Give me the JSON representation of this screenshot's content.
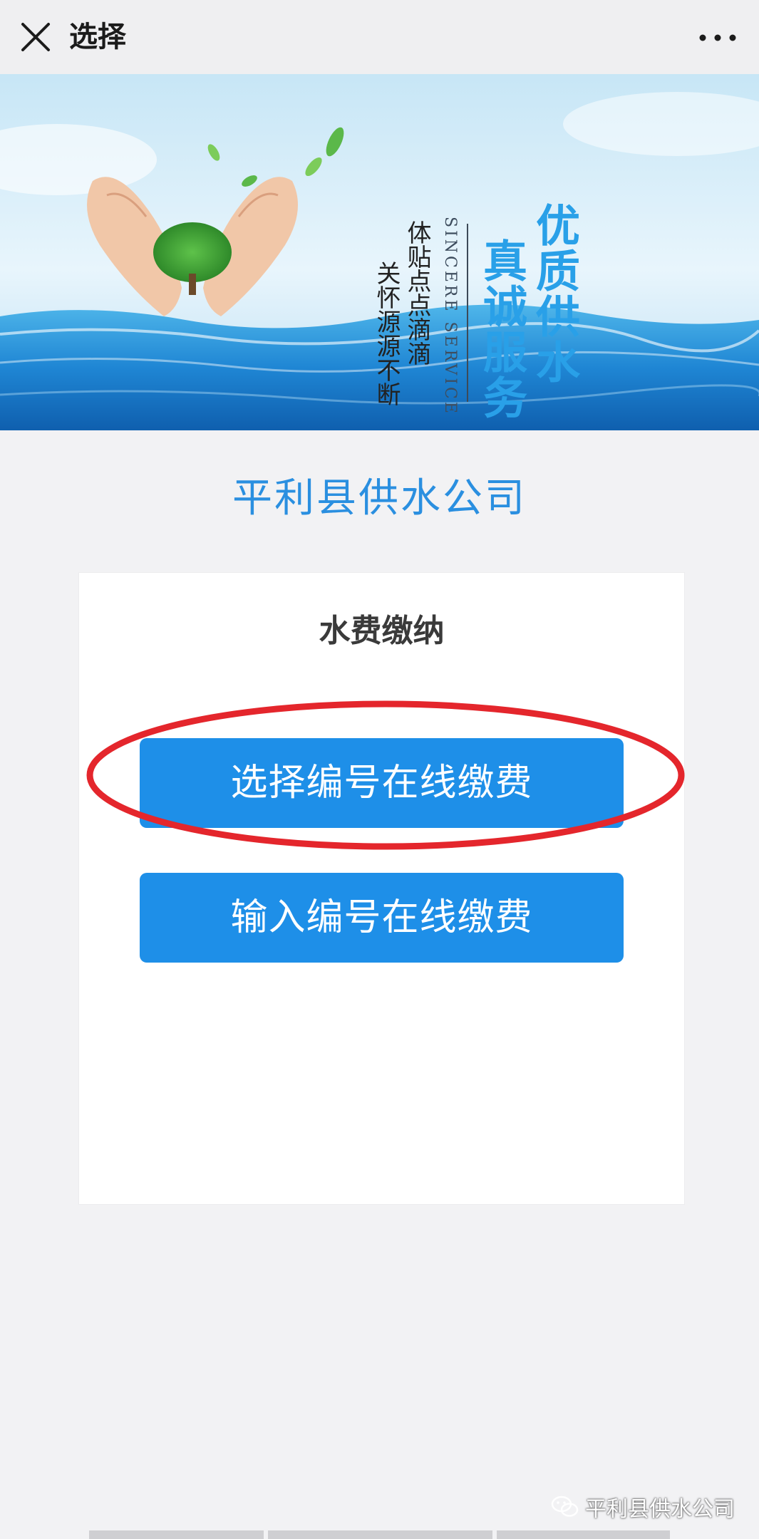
{
  "header": {
    "title": "选择",
    "close_icon": "close-icon",
    "more_icon": "more-dots-icon"
  },
  "banner": {
    "slogan_main_line1": "优质供水",
    "slogan_main_line2": "真诚服务",
    "slogan_english": "SINCERE SERVICE",
    "slogan_sub_line1": "体贴点点滴滴",
    "slogan_sub_line2": "关怀源源不断"
  },
  "main": {
    "company_name": "平利县供水公司",
    "card_title": "水费缴纳",
    "buttons": [
      {
        "label": "选择编号在线缴费"
      },
      {
        "label": "输入编号在线缴费"
      }
    ]
  },
  "annotation": {
    "highlight_color": "#e4262c"
  },
  "watermark": {
    "text": "平利县供水公司"
  },
  "colors": {
    "accent": "#1e8fe8",
    "company_name": "#2a8fe0",
    "background": "#f2f2f4"
  }
}
